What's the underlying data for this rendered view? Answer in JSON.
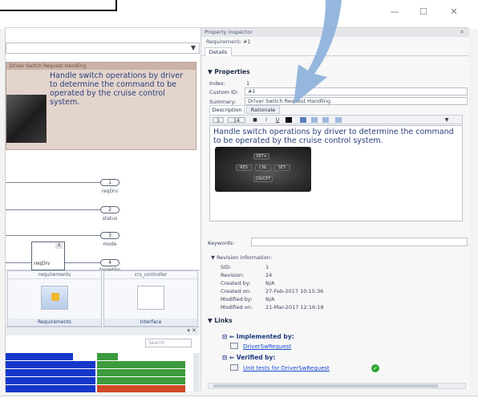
{
  "window": {
    "controls": {
      "minimize": "—",
      "maximize": "☐",
      "close": "✕"
    }
  },
  "model": {
    "requirement_note": {
      "title": "Driver Switch Request Handling",
      "text": "Handle switch operations by driver to determine the command to be operated by the cruise control system."
    },
    "ports": [
      {
        "num": "1",
        "label": "reqDrv"
      },
      {
        "num": "2",
        "label": "status"
      },
      {
        "num": "3",
        "label": "mode"
      },
      {
        "num": "4",
        "label": "targetSp"
      }
    ],
    "subsystem_label": "reqDrv",
    "subsystem_num": "3",
    "tiles": [
      {
        "top": "requirements",
        "bottom": "Requirements"
      },
      {
        "top": "crs_controller",
        "bottom": "Interface"
      }
    ],
    "search_placeholder": "Search"
  },
  "inspector": {
    "title": "Property Inspector",
    "subtitle": "Requirement: #1",
    "tab": "Details",
    "properties_header": "Properties",
    "fields": {
      "index_label": "Index:",
      "index_value": "1",
      "custom_id_label": "Custom ID:",
      "custom_id_value": "#1",
      "summary_label": "Summary:",
      "summary_value": "Driver Switch Request Handling"
    },
    "desc_tabs": [
      "Description",
      "Rationale"
    ],
    "toolbar": {
      "style": "1",
      "size": "14"
    },
    "description": "Handle switch operations by driver to determine the command to be operated by the cruise control system.",
    "wheel_buttons": [
      "SET+",
      "RES",
      "CNL",
      "SET-",
      "ON/OFF"
    ],
    "keywords_label": "Keywords:",
    "revision": {
      "header": "Revision information:",
      "rows": [
        {
          "label": "SID:",
          "value": "1"
        },
        {
          "label": "Revision:",
          "value": "24"
        },
        {
          "label": "Created by:",
          "value": "N/A"
        },
        {
          "label": "Created on:",
          "value": "27-Feb-2017 10:15:36"
        },
        {
          "label": "Modified by:",
          "value": "N/A"
        },
        {
          "label": "Modified on:",
          "value": "21-Mar-2017 12:16:18"
        }
      ]
    },
    "links": {
      "header": "Links",
      "implemented_label": "Implemented by:",
      "implemented_link": "DriverSwRequest",
      "verified_label": "Verified by:",
      "verified_link": "Unit tests for DriverSwRequest"
    }
  },
  "colors": {
    "note_bg": "#e3d4cc",
    "grid_blue": "#1538c9",
    "grid_green": "#3d9b3d",
    "grid_red": "#d24a2a",
    "arrow": "#8fb3dc"
  }
}
